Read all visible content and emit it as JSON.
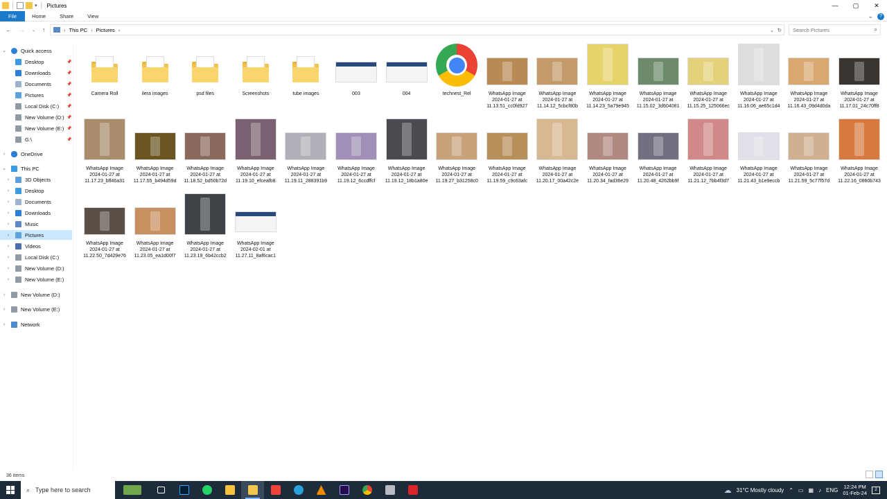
{
  "window": {
    "title": "Pictures",
    "controls": {
      "minimize": "—",
      "maximize": "▢",
      "close": "✕"
    }
  },
  "ribbon": {
    "tabs": [
      "File",
      "Home",
      "Share",
      "View"
    ],
    "help": "?",
    "collapse": "⌄"
  },
  "address": {
    "crumbs": [
      "This PC",
      "Pictures"
    ],
    "separator": "›",
    "search_placeholder": "Search Pictures"
  },
  "nav_pane": {
    "quick_access": "Quick access",
    "quick_items": [
      "Desktop",
      "Downloads",
      "Documents",
      "Pictures",
      "Local Disk (C:)",
      "New Volume (D:)",
      "New Volume (E:)",
      "G:\\"
    ],
    "onedrive": "OneDrive",
    "this_pc": "This PC",
    "pc_items": [
      "3D Objects",
      "Desktop",
      "Documents",
      "Downloads",
      "Music",
      "Pictures",
      "Videos",
      "Local Disk (C:)",
      "New Volume (D:)",
      "New Volume (E:)"
    ],
    "extra": [
      "New Volume (D:)",
      "New Volume (E:)",
      "Network"
    ]
  },
  "items": [
    {
      "name": "Camera Roll",
      "kind": "folder"
    },
    {
      "name": "ilera images",
      "kind": "folder"
    },
    {
      "name": "psd files",
      "kind": "folder"
    },
    {
      "name": "Screenshots",
      "kind": "folder"
    },
    {
      "name": "tube images",
      "kind": "folder"
    },
    {
      "name": "003",
      "kind": "screenshot"
    },
    {
      "name": "004",
      "kind": "screenshot"
    },
    {
      "name": "technest_Rel",
      "kind": "chrome"
    },
    {
      "name": "WhatsApp Image 2024-01-27 at 11.13.51_cc0fd927",
      "kind": "photo",
      "color": "#b98a55"
    },
    {
      "name": "WhatsApp Image 2024-01-27 at 11.14.12_5cbcf80b",
      "kind": "photo",
      "color": "#c49a6a"
    },
    {
      "name": "WhatsApp Image 2024-01-27 at 11.14.23_5a79e945",
      "kind": "photo",
      "color": "#e6d36a"
    },
    {
      "name": "WhatsApp Image 2024-01-27 at 11.15.02_3d604081",
      "kind": "photo",
      "color": "#6d8a6a"
    },
    {
      "name": "WhatsApp Image 2024-01-27 at 11.15.25_125066ec",
      "kind": "photo",
      "color": "#e3d27a"
    },
    {
      "name": "WhatsApp Image 2024-01-27 at 11.16.06_ae65c1d4",
      "kind": "photo",
      "color": "#dddddd"
    },
    {
      "name": "WhatsApp Image 2024-01-27 at 11.16.43_09d4d0da",
      "kind": "photo",
      "color": "#d8a870"
    },
    {
      "name": "WhatsApp Image 2024-01-27 at 11.17.01_24c70ff8",
      "kind": "photo",
      "color": "#3a3530"
    },
    {
      "name": "WhatsApp Image 2024-01-27 at 11.17.23_bff46a31",
      "kind": "photo",
      "color": "#a88c6c"
    },
    {
      "name": "WhatsApp Image 2024-01-27 at 11.17.55_b494d59d",
      "kind": "photo",
      "color": "#6a5520"
    },
    {
      "name": "WhatsApp Image 2024-01-27 at 11.18.52_bd50b72d",
      "kind": "photo",
      "color": "#8a6a5c"
    },
    {
      "name": "WhatsApp Image 2024-01-27 at 11.19.10_efceafb8",
      "kind": "photo",
      "color": "#7a6070"
    },
    {
      "name": "WhatsApp Image 2024-01-27 at 11.19.11_288391b9",
      "kind": "photo",
      "color": "#b0b0b8"
    },
    {
      "name": "WhatsApp Image 2024-01-27 at 11.19.12_6ccdffcf",
      "kind": "photo",
      "color": "#a090b8"
    },
    {
      "name": "WhatsApp Image 2024-01-27 at 11.19.12_18b1a80e",
      "kind": "photo",
      "color": "#4a4a50"
    },
    {
      "name": "WhatsApp Image 2024-01-27 at 11.19.27_b31258c0",
      "kind": "photo",
      "color": "#c8a27a"
    },
    {
      "name": "WhatsApp Image 2024-01-27 at 11.19.59_c9c63afc",
      "kind": "photo",
      "color": "#b8905c"
    },
    {
      "name": "WhatsApp Image 2024-01-27 at 11.20.17_00a42c2e",
      "kind": "photo",
      "color": "#d8b890"
    },
    {
      "name": "WhatsApp Image 2024-01-27 at 11.20.34_fad36e29",
      "kind": "photo",
      "color": "#b08a80"
    },
    {
      "name": "WhatsApp Image 2024-01-27 at 11.20.48_4262bb9f",
      "kind": "photo",
      "color": "#707080"
    },
    {
      "name": "WhatsApp Image 2024-01-27 at 11.21.12_7bb4f3d7",
      "kind": "photo",
      "color": "#d08888"
    },
    {
      "name": "WhatsApp Image 2024-01-27 at 11.21.43_b1e9eccb",
      "kind": "photo",
      "color": "#e0e0e8"
    },
    {
      "name": "WhatsApp Image 2024-01-27 at 11.21.59_5c77f57d",
      "kind": "photo",
      "color": "#d0b090"
    },
    {
      "name": "WhatsApp Image 2024-01-27 at 11.22.16_0860b743",
      "kind": "photo",
      "color": "#d87a40"
    },
    {
      "name": "WhatsApp Image 2024-01-27 at 11.22.50_7d429e76",
      "kind": "photo",
      "color": "#5a5048"
    },
    {
      "name": "WhatsApp Image 2024-01-27 at 11.23.05_ea1d00f7",
      "kind": "photo",
      "color": "#c89060"
    },
    {
      "name": "WhatsApp Image 2024-01-27 at 11.23.19_6b42ccb2",
      "kind": "photo",
      "color": "#404448"
    },
    {
      "name": "WhatsApp Image 2024-02-01 at 11.27.11_8af6cac1",
      "kind": "screenshot"
    }
  ],
  "status": {
    "count": "36 items"
  },
  "taskbar": {
    "search_placeholder": "Type here to search",
    "weather": "31°C  Mostly cloudy",
    "lang": "ENG",
    "time": "12:24 PM",
    "date": "01-Feb-24",
    "notify": "2"
  }
}
